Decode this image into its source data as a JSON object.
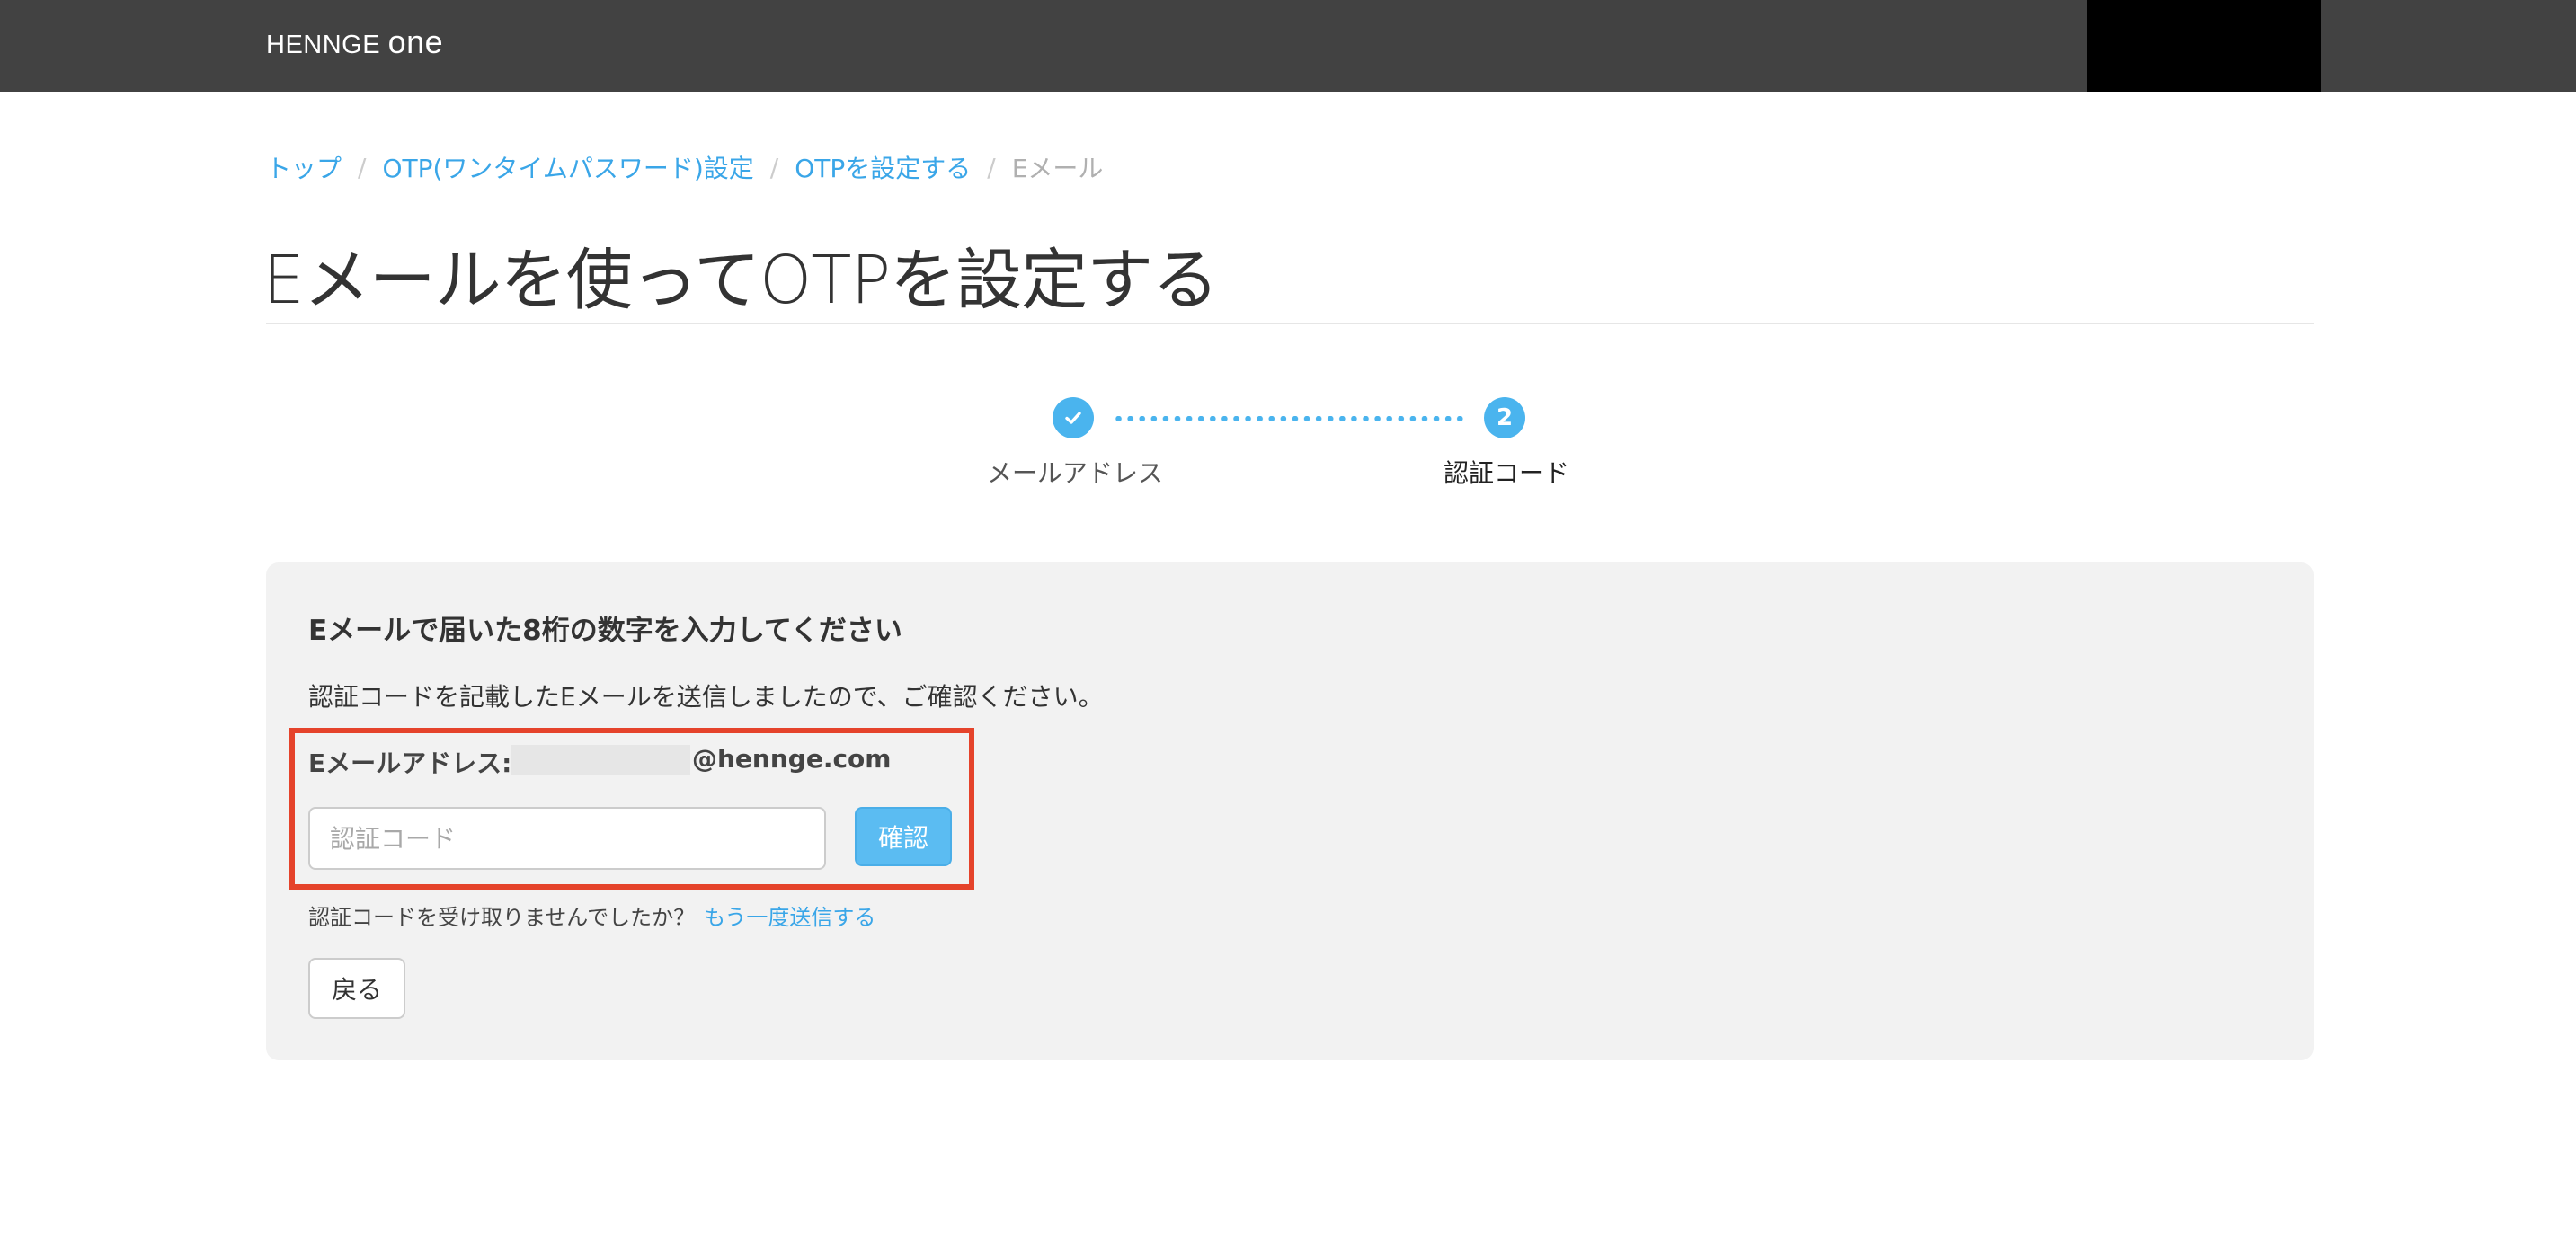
{
  "header": {
    "logo_main": "HENNGE ",
    "logo_one": "one"
  },
  "breadcrumb": {
    "items": [
      {
        "label": "トップ"
      },
      {
        "label": "OTP(ワンタイムパスワード)設定"
      },
      {
        "label": "OTPを設定する"
      }
    ],
    "current": "Eメール",
    "separator": "/"
  },
  "page": {
    "title": "Eメールを使ってOTPを設定する"
  },
  "stepper": {
    "steps": [
      {
        "number": "1",
        "label": "メールアドレス",
        "status": "completed"
      },
      {
        "number": "2",
        "label": "認証コード",
        "status": "active"
      }
    ],
    "accent_color": "#4ab4ee"
  },
  "form": {
    "heading": "Eメールで届いた8桁の数字を入力してください",
    "description": "認証コードを記載したEメールを送信しましたので、ご確認ください。",
    "email_label": "Eメールアドレス:",
    "email_domain": "@hennge.com",
    "code_placeholder": "認証コード",
    "code_value": "",
    "confirm_label": "確認",
    "resend_text": "認証コードを受け取りませんでしたか？",
    "resend_link": "もう一度送信する",
    "back_label": "戻る"
  },
  "colors": {
    "header_bg": "#424242",
    "link": "#3aa6e8",
    "highlight": "#e5432b",
    "panel_bg": "#f2f2f2"
  }
}
